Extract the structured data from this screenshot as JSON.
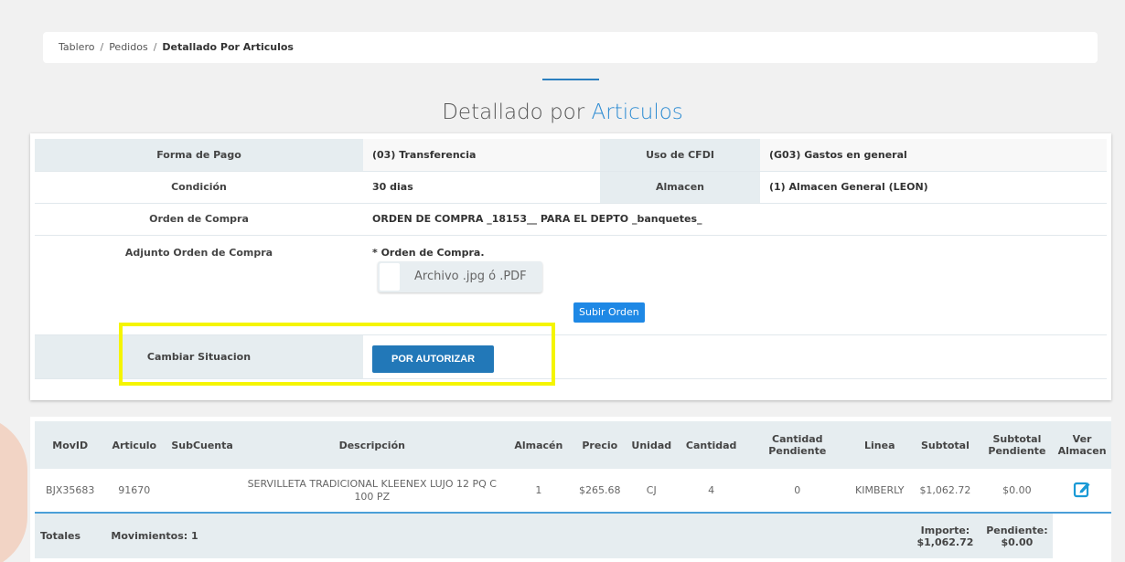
{
  "breadcrumb": {
    "items": [
      "Tablero",
      "Pedidos"
    ],
    "current": "Detallado Por Articulos",
    "separator": "/"
  },
  "title": {
    "main": "Detallado por",
    "accent": "Articulos"
  },
  "info": {
    "forma_pago_label": "Forma de Pago",
    "forma_pago_value": "(03) Transferencia",
    "uso_cfdi_label": "Uso de CFDI",
    "uso_cfdi_value": "(G03) Gastos en general",
    "condicion_label": "Condición",
    "condicion_value": "30 dias",
    "almacen_label": "Almacen",
    "almacen_value": "(1) Almacen General (LEON)",
    "orden_label": "Orden de Compra",
    "orden_value": "ORDEN DE COMPRA _18153__ PARA EL DEPTO _banquetes_",
    "adjunto_label": "Adjunto Orden de Compra",
    "adjunto_caption": "* Orden de Compra.",
    "file_placeholder": "Archivo .jpg ó .PDF",
    "upload_label": "Subir Orden",
    "situacion_label": "Cambiar Situacion",
    "situacion_button": "POR AUTORIZAR"
  },
  "table": {
    "headers": [
      "MovID",
      "Articulo",
      "SubCuenta",
      "Descripción",
      "Almacén",
      "Precio",
      "Unidad",
      "Cantidad",
      "Cantidad Pendiente",
      "Linea",
      "Subtotal",
      "Subtotal Pendiente",
      "Ver Almacen"
    ],
    "rows": [
      {
        "movid": "BJX35683",
        "articulo": "91670",
        "subcuenta": "",
        "descripcion": "SERVILLETA TRADICIONAL KLEENEX LUJO 12 PQ C 100 PZ",
        "almacen": "1",
        "precio": "$265.68",
        "unidad": "CJ",
        "cantidad": "4",
        "pendiente": "0",
        "linea": "KIMBERLY",
        "subtotal": "$1,062.72",
        "subtotal_pendiente": "$0.00"
      }
    ],
    "totals": {
      "label": "Totales",
      "movimientos": "Movimientos: 1",
      "importe_label": "Importe:",
      "importe_value": "$1,062.72",
      "pendiente_label": "Pendiente:",
      "pendiente_value": "$0.00"
    }
  },
  "colors": {
    "accent": "#2c8bd2",
    "button": "#2278b8",
    "highlight": "#f5f500",
    "header_bg": "#e6edf0"
  },
  "icons": {
    "ver_almacen": "edit-icon"
  }
}
